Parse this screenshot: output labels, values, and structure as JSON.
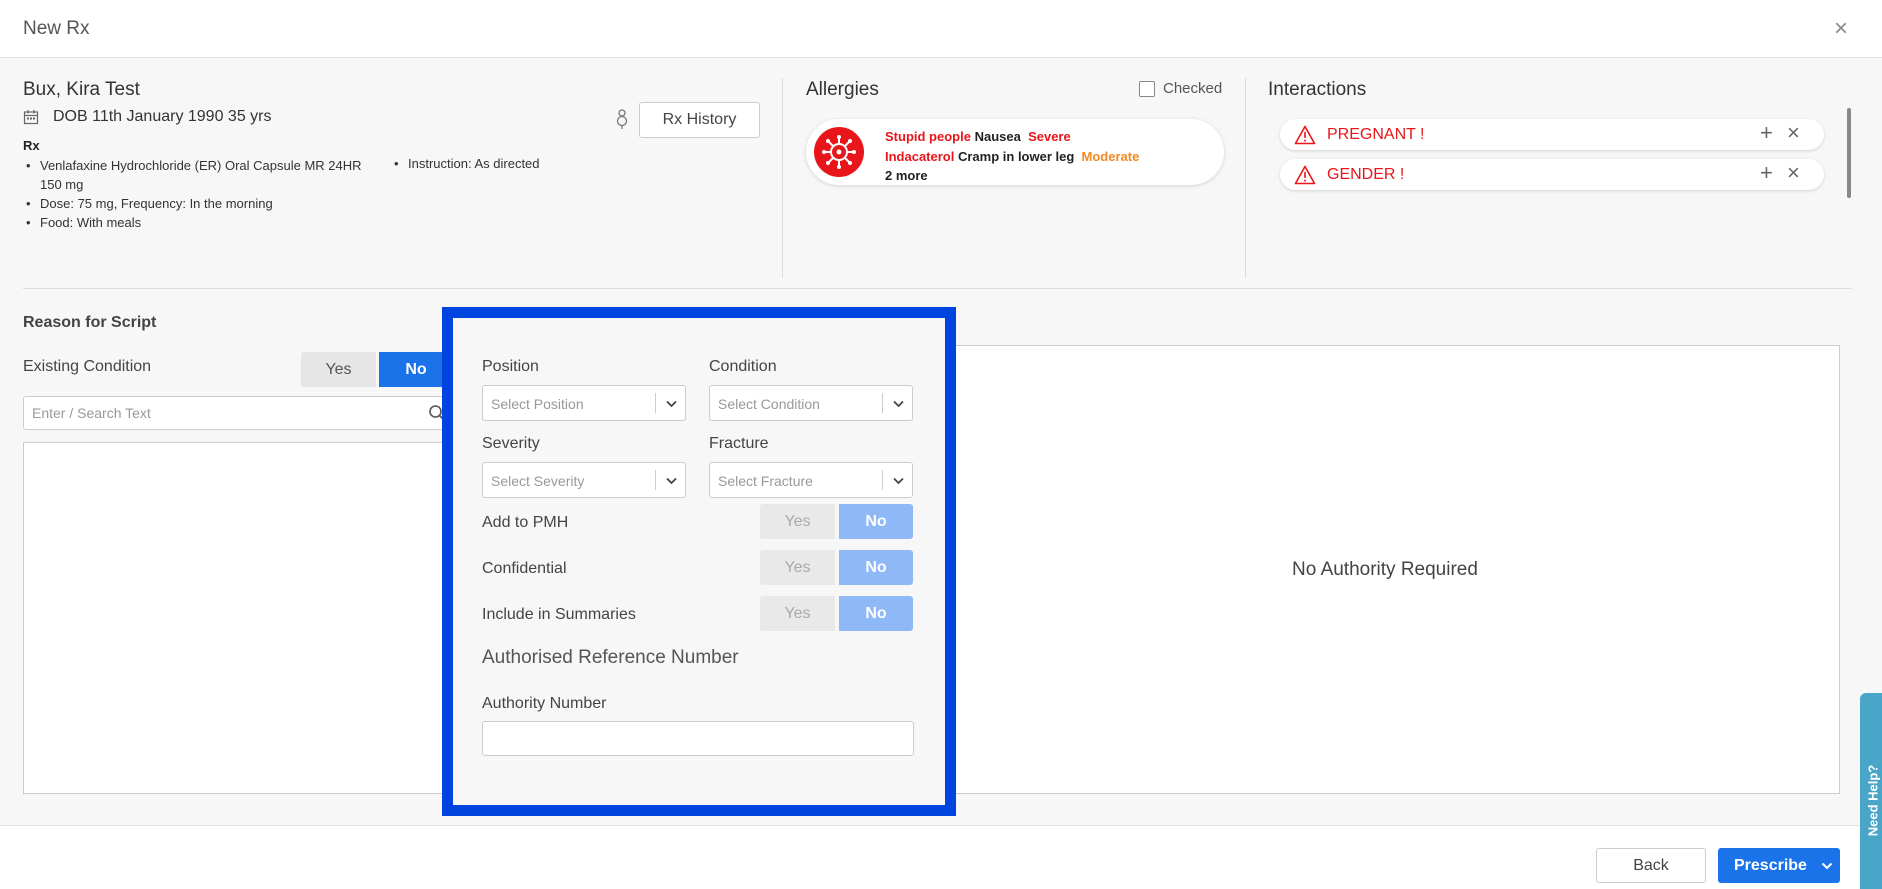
{
  "window": {
    "title": "New Rx",
    "close_glyph": "×"
  },
  "patient": {
    "name": "Bux, Kira Test",
    "dob": "DOB 11th January 1990 35 yrs",
    "rx_history_label": "Rx History",
    "rx_label": "Rx",
    "rx_items": [
      "Venlafaxine Hydrochloride (ER) Oral Capsule MR 24HR",
      "150 mg",
      "Dose: 75 mg, Frequency: In the morning",
      "Food: With meals"
    ],
    "instruction": "Instruction: As directed"
  },
  "allergies": {
    "title": "Allergies",
    "checked_label": "Checked",
    "lines": [
      {
        "agent": "Stupid people",
        "reaction": "Nausea",
        "severity": "Severe"
      },
      {
        "agent": "Indacaterol",
        "reaction": "Cramp in lower leg",
        "severity": "Moderate"
      }
    ],
    "more": "2 more"
  },
  "interactions": {
    "title": "Interactions",
    "items": [
      {
        "label": "PREGNANT !"
      },
      {
        "label": "GENDER !"
      }
    ]
  },
  "reason": {
    "title": "Reason for Script",
    "existing_label": "Existing Condition",
    "yes": "Yes",
    "no": "No",
    "search_placeholder": "Enter / Search Text",
    "no_authority": "No Authority Required"
  },
  "panel": {
    "position_label": "Position",
    "position_placeholder": "Select Position",
    "condition_label": "Condition",
    "condition_placeholder": "Select Condition",
    "severity_label": "Severity",
    "severity_placeholder": "Select Severity",
    "fracture_label": "Fracture",
    "fracture_placeholder": "Select Fracture",
    "toggles": [
      {
        "label": "Add to PMH",
        "yes": "Yes",
        "no": "No"
      },
      {
        "label": "Confidential",
        "yes": "Yes",
        "no": "No"
      },
      {
        "label": "Include in Summaries",
        "yes": "Yes",
        "no": "No"
      }
    ],
    "auth_title": "Authorised Reference Number",
    "authority_number_label": "Authority Number",
    "authority_number_value": ""
  },
  "footer": {
    "back": "Back",
    "prescribe": "Prescribe"
  },
  "help": {
    "label": "Need Help?"
  },
  "colors": {
    "accent": "#1a73e8",
    "alert": "#e8161b",
    "moderate": "#f08a24",
    "overlay_border": "#0044e0"
  }
}
